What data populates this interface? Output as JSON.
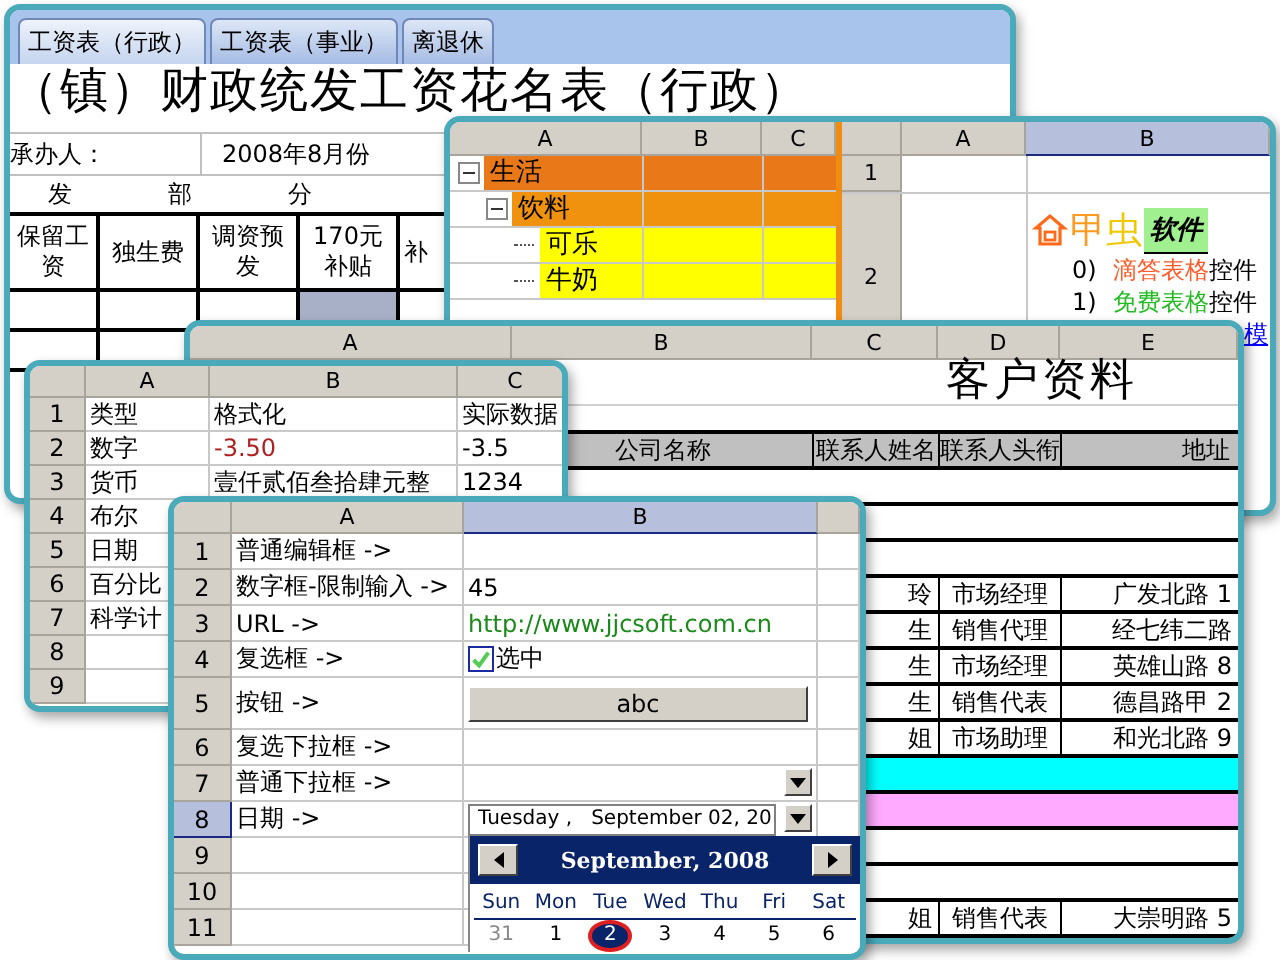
{
  "salary_window": {
    "tabs": [
      {
        "label": "工资表（行政）",
        "selected": true
      },
      {
        "label": "工资表（事业）",
        "selected": false
      },
      {
        "label": "离退休",
        "selected": false
      }
    ],
    "title": "（镇）财政统发工资花名表（行政）",
    "handler_label": "承办人：",
    "month": "2008年8月份",
    "section": [
      "发",
      "部",
      "分"
    ],
    "columns": [
      [
        "保留工",
        "资"
      ],
      [
        "独生费"
      ],
      [
        "调资预",
        "发"
      ],
      [
        "170元",
        "补贴"
      ],
      [
        "补"
      ]
    ]
  },
  "tree_window": {
    "columns": [
      "A",
      "B",
      "C"
    ],
    "tree": [
      {
        "label": "生活",
        "color": "#e87818",
        "expanded": true,
        "children": [
          {
            "label": "饮料",
            "color": "#f0920e",
            "expanded": true,
            "children": [
              {
                "label": "可乐",
                "color": "#ffff00"
              },
              {
                "label": "牛奶",
                "color": "#ffff00"
              }
            ]
          }
        ]
      }
    ],
    "right_columns": [
      {
        "label": "A",
        "selected": false
      },
      {
        "label": "B",
        "selected": true
      }
    ],
    "row_numbers": [
      "1",
      "2"
    ],
    "logo": [
      "甲",
      "虫"
    ],
    "soft": "软件",
    "lines": [
      {
        "number": "0)",
        "name": "滴答表格",
        "suffix": "控件",
        "color": "#ff5a28"
      },
      {
        "number": "1)",
        "name": "免费表格",
        "suffix": "控件",
        "color": "#22bb22"
      }
    ],
    "partial_link": "模"
  },
  "customer_window": {
    "columns": [
      "A",
      "B",
      "C",
      "D",
      "E"
    ],
    "title": "客户资料",
    "headers": [
      "公司名称",
      "联系人姓名",
      "联系人头衔",
      "地址"
    ],
    "rows": [
      {
        "kind": "empty"
      },
      {
        "kind": "empty"
      },
      {
        "kind": "empty"
      },
      {
        "kind": "record",
        "cells": [
          "玲",
          "市场经理",
          "广发北路 1"
        ]
      },
      {
        "kind": "record",
        "cells": [
          "生",
          "销售代理",
          "经七纬二路"
        ]
      },
      {
        "kind": "record",
        "cells": [
          "生",
          "市场经理",
          "英雄山路 8"
        ]
      },
      {
        "kind": "record",
        "cells": [
          "生",
          "销售代表",
          "德昌路甲 2"
        ]
      },
      {
        "kind": "record",
        "cells": [
          "姐",
          "市场助理",
          "和光北路 9"
        ]
      },
      {
        "kind": "band",
        "color": "#00ffff"
      },
      {
        "kind": "band",
        "color": "#ffaaff"
      },
      {
        "kind": "empty"
      },
      {
        "kind": "empty"
      },
      {
        "kind": "record",
        "cells": [
          "姐",
          "销售代表",
          "大崇明路 5"
        ]
      }
    ]
  },
  "format_window": {
    "columns": [
      "A",
      "B",
      "C"
    ],
    "rows": [
      {
        "number": "1",
        "cells": [
          {
            "text": "类型"
          },
          {
            "text": "格式化"
          },
          {
            "text": "实际数据"
          }
        ]
      },
      {
        "number": "2",
        "cells": [
          {
            "text": "数字"
          },
          {
            "text": "-3.50",
            "negative": true
          },
          {
            "text": "-3.5"
          }
        ]
      },
      {
        "number": "3",
        "cells": [
          {
            "text": "货币"
          },
          {
            "text": "壹仟贰佰叁拾肆元整"
          },
          {
            "text": "1234"
          }
        ]
      },
      {
        "number": "4",
        "cells": [
          {
            "text": "布尔"
          }
        ]
      },
      {
        "number": "5",
        "cells": [
          {
            "text": "日期"
          }
        ]
      },
      {
        "number": "6",
        "cells": [
          {
            "text": "百分比"
          }
        ]
      },
      {
        "number": "7",
        "cells": [
          {
            "text": "科学计"
          }
        ]
      },
      {
        "number": "8",
        "cells": []
      },
      {
        "number": "9",
        "cells": []
      }
    ]
  },
  "controls_window": {
    "columns": [
      {
        "label": "A",
        "selected": false
      },
      {
        "label": "B",
        "selected": true
      }
    ],
    "rows": [
      {
        "number": "1",
        "selected": false,
        "label": "普通编辑框 ->",
        "kind": "blank"
      },
      {
        "number": "2",
        "selected": false,
        "label": "数字框-限制输入 ->",
        "kind": "text",
        "value": "45"
      },
      {
        "number": "3",
        "selected": false,
        "label": "URL ->",
        "kind": "url",
        "value": "http://www.jjcsoft.com.cn"
      },
      {
        "number": "4",
        "selected": false,
        "label": "复选框 ->",
        "kind": "checkbox",
        "checked": true,
        "value": "选中"
      },
      {
        "number": "5",
        "selected": false,
        "label": "按钮 ->",
        "kind": "button",
        "value": "abc"
      },
      {
        "number": "6",
        "selected": false,
        "label": "复选下拉框 ->",
        "kind": "blank"
      },
      {
        "number": "7",
        "selected": false,
        "label": "普通下拉框 ->",
        "kind": "dropdown"
      },
      {
        "number": "8",
        "selected": true,
        "label": "日期 ->",
        "kind": "date",
        "value": "Tuesday ,   September 02, 20"
      },
      {
        "number": "9",
        "selected": false,
        "kind": "blank"
      },
      {
        "number": "10",
        "selected": false,
        "kind": "blank"
      },
      {
        "number": "11",
        "selected": false,
        "kind": "blank"
      }
    ],
    "calendar": {
      "month": "September, 2008",
      "weekdays": [
        "Sun",
        "Mon",
        "Tue",
        "Wed",
        "Thu",
        "Fri",
        "Sat"
      ],
      "days": [
        {
          "label": "31",
          "outside": true,
          "selected": false
        },
        {
          "label": "1",
          "outside": false,
          "selected": false
        },
        {
          "label": "2",
          "outside": false,
          "selected": true
        },
        {
          "label": "3",
          "outside": false,
          "selected": false
        },
        {
          "label": "4",
          "outside": false,
          "selected": false
        },
        {
          "label": "5",
          "outside": false,
          "selected": false
        },
        {
          "label": "6",
          "outside": false,
          "selected": false
        }
      ]
    }
  }
}
